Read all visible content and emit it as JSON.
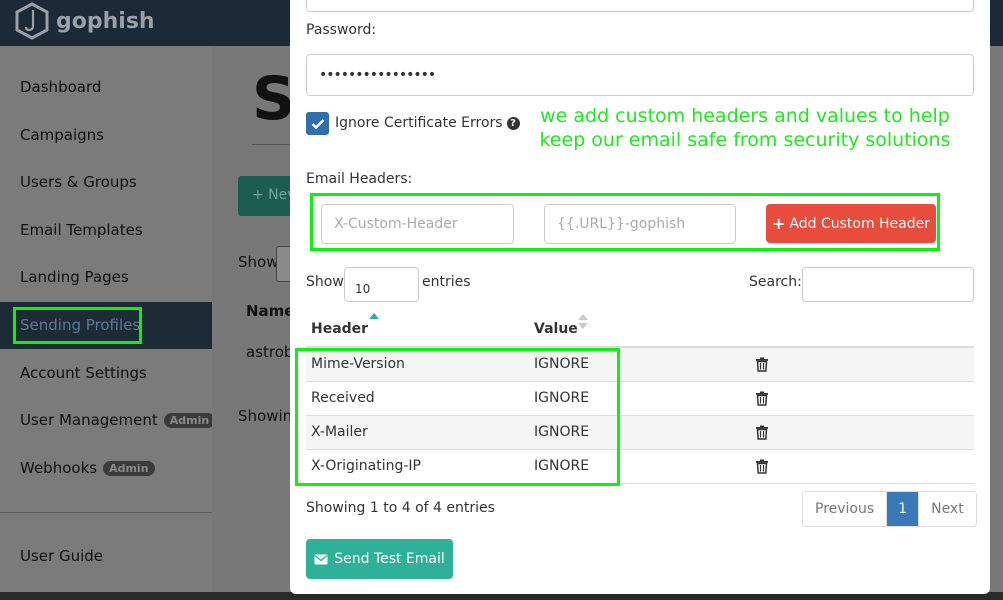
{
  "app": {
    "logo_text": "gophish"
  },
  "sidebar": {
    "items": [
      {
        "label": "Dashboard"
      },
      {
        "label": "Campaigns"
      },
      {
        "label": "Users & Groups"
      },
      {
        "label": "Email Templates"
      },
      {
        "label": "Landing Pages"
      },
      {
        "label": "Sending Profiles",
        "active": true
      },
      {
        "label": "Account Settings"
      },
      {
        "label": "User Management",
        "badge": "Admin"
      },
      {
        "label": "Webhooks",
        "badge": "Admin"
      },
      {
        "label": "User Guide"
      }
    ]
  },
  "background": {
    "page_title_fragment": "S",
    "new_button_fragment": "+ Nev",
    "show_label": "Show",
    "name_header_fragment": "Name",
    "row_fragment": "astrob",
    "showing_fragment": "Showing"
  },
  "modal": {
    "password_label": "Password:",
    "password_value": "••••••••••••••••",
    "ignore_cert_label": "Ignore Certificate Errors",
    "email_headers_label": "Email Headers:",
    "header_placeholder": "X-Custom-Header",
    "value_placeholder": "{{.URL}}-gophish",
    "add_header_button": "Add Custom Header",
    "show_label": "Show",
    "entries_label": "entries",
    "page_length": "10",
    "search_label": "Search:",
    "table": {
      "columns": [
        "Header",
        "Value"
      ],
      "rows": [
        {
          "header": "Mime-Version",
          "value": "IGNORE"
        },
        {
          "header": "Received",
          "value": "IGNORE"
        },
        {
          "header": "X-Mailer",
          "value": "IGNORE"
        },
        {
          "header": "X-Originating-IP",
          "value": "IGNORE"
        }
      ]
    },
    "showing_text": "Showing 1 to 4 of 4 entries",
    "pagination": {
      "previous": "Previous",
      "current": "1",
      "next": "Next"
    },
    "send_test_button": "Send Test Email"
  },
  "annotation": {
    "line1": "we add custom headers and values to help",
    "line2": "keep our email safe from security solutions"
  },
  "colors": {
    "highlight": "#0ef00e",
    "annotation_text": "#22e622",
    "danger": "#e74c3c",
    "primary": "#2eb099",
    "pager_active": "#3a79b7"
  }
}
